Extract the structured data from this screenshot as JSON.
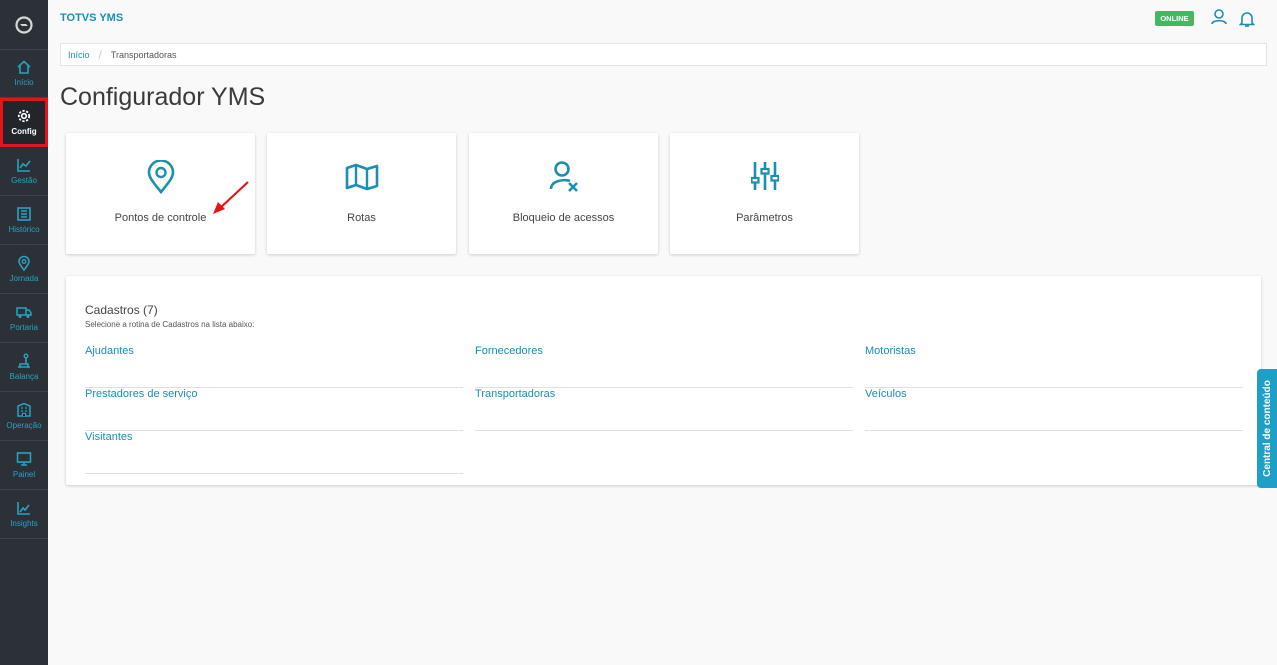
{
  "app": {
    "title": "TOTVS YMS",
    "status": "ONLINE"
  },
  "sidebar": {
    "items": [
      {
        "label": "Início",
        "icon": "home-icon"
      },
      {
        "label": "Config",
        "icon": "gear-icon",
        "active": true
      },
      {
        "label": "Gestão",
        "icon": "chart-icon"
      },
      {
        "label": "Histórico",
        "icon": "history-icon"
      },
      {
        "label": "Jornada",
        "icon": "pin-icon"
      },
      {
        "label": "Portaria",
        "icon": "truck-icon"
      },
      {
        "label": "Balança",
        "icon": "scale-icon"
      },
      {
        "label": "Operação",
        "icon": "building-icon"
      },
      {
        "label": "Painel",
        "icon": "monitor-icon"
      },
      {
        "label": "Insights",
        "icon": "insights-icon"
      }
    ]
  },
  "breadcrumb": {
    "home": "Início",
    "current": "Transportadoras"
  },
  "page": {
    "title": "Configurador YMS"
  },
  "cards": [
    {
      "label": "Pontos de controle",
      "icon": "map-pin-icon"
    },
    {
      "label": "Rotas",
      "icon": "map-icon"
    },
    {
      "label": "Bloqueio de acessos",
      "icon": "user-block-icon"
    },
    {
      "label": "Parâmetros",
      "icon": "sliders-icon"
    }
  ],
  "cadastros": {
    "title": "Cadastros (7)",
    "subtitle": "Selecione a rotina de Cadastros na lista abaixo:",
    "links": [
      "Ajudantes",
      "Fornecedores",
      "Motoristas",
      "Prestadores de serviço",
      "Transportadoras",
      "Veículos",
      "Visitantes"
    ]
  },
  "side_tab": {
    "label": "Central de conteúdo"
  },
  "colors": {
    "accent": "#1a8fb0",
    "sidebar": "#2c3137",
    "online": "#3fba62",
    "highlight": "#e3151b"
  }
}
